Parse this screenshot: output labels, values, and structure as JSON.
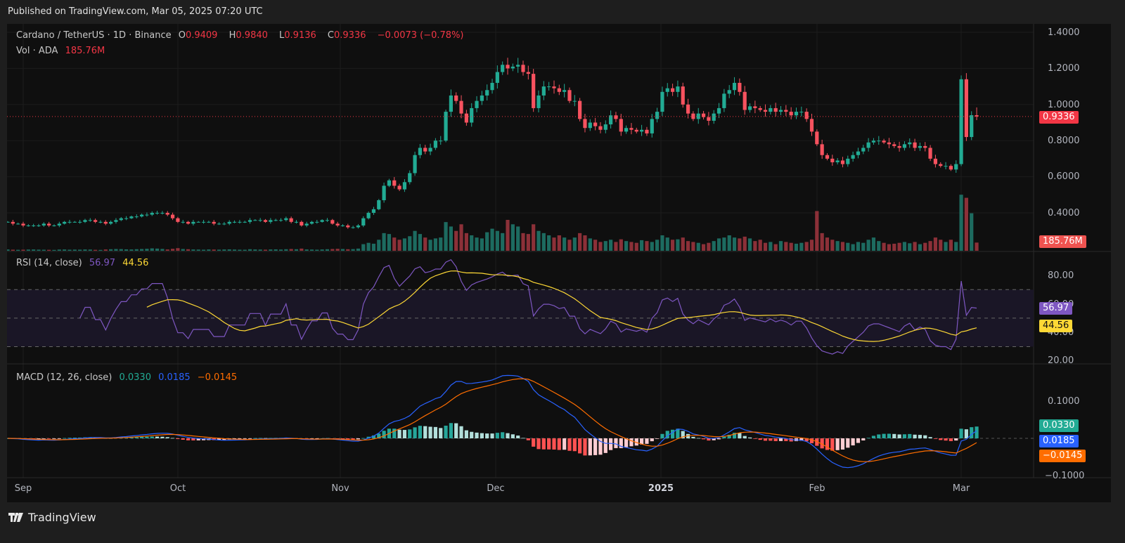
{
  "published": "Published on TradingView.com, Mar 05, 2025 07:20 UTC",
  "header": {
    "symbol": "Cardano / TetherUS · 1D · Binance",
    "o_label": "O",
    "o": "0.9409",
    "h_label": "H",
    "h": "0.9840",
    "l_label": "L",
    "l": "0.9136",
    "c_label": "C",
    "c": "0.9336",
    "change": "−0.0073 (−0.78%)",
    "vol_label": "Vol · ADA",
    "vol": "185.76M"
  },
  "rsi_legend": {
    "label": "RSI (14, close)",
    "rsi": "56.97",
    "ma": "44.56"
  },
  "macd_legend": {
    "label": "MACD (12, 26, close)",
    "hist": "0.0330",
    "macd": "0.0185",
    "signal": "−0.0145"
  },
  "badges": {
    "price": "0.9336",
    "volume": "185.76M",
    "rsi": "56.97",
    "rsi_ma": "44.56",
    "hist": "0.0330",
    "macd": "0.0185",
    "signal": "−0.0145"
  },
  "price_axis": [
    "1.4000",
    "1.2000",
    "1.0000",
    "0.8000",
    "0.6000",
    "0.4000"
  ],
  "rsi_axis": [
    "80.00",
    "60.00",
    "40.00",
    "20.00"
  ],
  "macd_axis": [
    "0.1000",
    "−0.1000"
  ],
  "time_axis": [
    "Sep",
    "Oct",
    "Nov",
    "Dec",
    "2025",
    "Feb",
    "Mar"
  ],
  "logo_text": "TradingView",
  "colors": {
    "up": "#22ab94",
    "down": "#f7525f",
    "rsi": "#7e57c2",
    "rsi_ma": "#fdd835",
    "macd": "#2962ff",
    "signal": "#ff6d00"
  },
  "chart_data": {
    "type": "candlestick",
    "title": "Cardano / TetherUS · 1D · Binance",
    "start_date": "2024-08-29",
    "end_date": "2025-03-05",
    "last_ohlc": {
      "open": 0.9409,
      "high": 0.984,
      "low": 0.9136,
      "close": 0.9336
    },
    "close": [
      0.35,
      0.34,
      0.34,
      0.33,
      0.33,
      0.33,
      0.33,
      0.34,
      0.33,
      0.33,
      0.34,
      0.35,
      0.35,
      0.35,
      0.35,
      0.36,
      0.36,
      0.35,
      0.35,
      0.34,
      0.35,
      0.36,
      0.37,
      0.37,
      0.38,
      0.38,
      0.39,
      0.39,
      0.4,
      0.4,
      0.4,
      0.39,
      0.37,
      0.35,
      0.35,
      0.34,
      0.35,
      0.35,
      0.35,
      0.35,
      0.34,
      0.34,
      0.34,
      0.35,
      0.35,
      0.35,
      0.35,
      0.36,
      0.36,
      0.36,
      0.35,
      0.36,
      0.36,
      0.36,
      0.37,
      0.35,
      0.35,
      0.33,
      0.34,
      0.35,
      0.35,
      0.36,
      0.36,
      0.34,
      0.33,
      0.33,
      0.32,
      0.32,
      0.33,
      0.37,
      0.4,
      0.42,
      0.47,
      0.55,
      0.58,
      0.55,
      0.53,
      0.57,
      0.62,
      0.72,
      0.76,
      0.74,
      0.76,
      0.8,
      0.8,
      0.96,
      1.05,
      1.02,
      0.95,
      0.9,
      0.98,
      1.02,
      1.05,
      1.08,
      1.12,
      1.18,
      1.22,
      1.2,
      1.21,
      1.22,
      1.18,
      1.17,
      0.98,
      1.05,
      1.1,
      1.1,
      1.09,
      1.07,
      1.08,
      1.02,
      1.02,
      0.92,
      0.87,
      0.9,
      0.88,
      0.86,
      0.89,
      0.94,
      0.92,
      0.85,
      0.87,
      0.86,
      0.85,
      0.86,
      0.84,
      0.92,
      0.96,
      1.07,
      1.09,
      1.07,
      1.1,
      1.0,
      0.95,
      0.92,
      0.95,
      0.93,
      0.91,
      0.95,
      0.98,
      1.06,
      1.08,
      1.12,
      1.07,
      0.97,
      0.99,
      0.98,
      0.97,
      0.96,
      0.98,
      0.96,
      0.97,
      0.96,
      0.94,
      0.96,
      0.96,
      0.92,
      0.85,
      0.78,
      0.72,
      0.7,
      0.68,
      0.69,
      0.67,
      0.7,
      0.72,
      0.74,
      0.76,
      0.79,
      0.8,
      0.8,
      0.79,
      0.78,
      0.77,
      0.76,
      0.78,
      0.79,
      0.76,
      0.77,
      0.76,
      0.7,
      0.67,
      0.66,
      0.66,
      0.64,
      0.67,
      1.14,
      0.82,
      0.9409,
      0.9336
    ],
    "volume_millions": [
      30,
      25,
      22,
      25,
      28,
      30,
      26,
      24,
      22,
      20,
      28,
      30,
      25,
      27,
      26,
      30,
      28,
      22,
      20,
      30,
      35,
      40,
      38,
      32,
      30,
      36,
      40,
      45,
      55,
      50,
      42,
      30,
      45,
      60,
      40,
      35,
      30,
      28,
      25,
      30,
      28,
      26,
      30,
      32,
      28,
      25,
      24,
      35,
      30,
      28,
      25,
      30,
      32,
      28,
      35,
      40,
      35,
      50,
      30,
      28,
      25,
      30,
      35,
      40,
      45,
      40,
      35,
      38,
      50,
      150,
      180,
      160,
      250,
      400,
      380,
      300,
      250,
      280,
      330,
      450,
      380,
      300,
      250,
      280,
      300,
      650,
      550,
      450,
      600,
      400,
      350,
      300,
      280,
      420,
      500,
      450,
      400,
      700,
      600,
      550,
      400,
      380,
      600,
      450,
      400,
      350,
      300,
      350,
      300,
      250,
      300,
      400,
      350,
      280,
      250,
      200,
      220,
      250,
      200,
      260,
      220,
      200,
      180,
      240,
      220,
      200,
      250,
      350,
      300,
      250,
      260,
      300,
      220,
      200,
      180,
      150,
      180,
      220,
      280,
      300,
      350,
      300,
      280,
      320,
      280,
      220,
      250,
      180,
      200,
      150,
      220,
      200,
      180,
      160,
      180,
      200,
      250,
      900,
      400,
      300,
      250,
      220,
      200,
      180,
      150,
      200,
      180,
      250,
      300,
      220,
      180,
      150,
      160,
      180,
      200,
      170,
      200,
      150,
      180,
      220,
      300,
      250,
      200,
      250,
      200,
      1270,
      1200,
      850,
      185.76
    ],
    "price_range": [
      0.3,
      1.45
    ],
    "rsi_range": [
      15,
      95
    ],
    "rsi_levels": [
      70,
      50,
      30
    ],
    "macd_range": [
      -0.11,
      0.19
    ],
    "indicators": [
      "Volume",
      "RSI (14, close)",
      "MACD (12, 26, close)"
    ]
  }
}
